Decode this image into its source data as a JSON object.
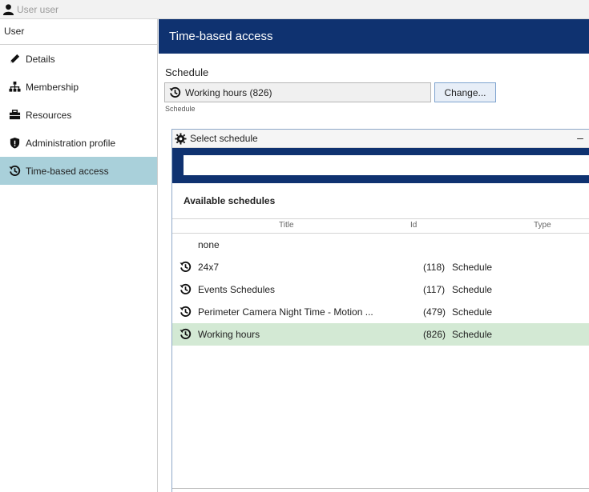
{
  "window": {
    "title": "User user"
  },
  "sidebar": {
    "header": "User",
    "items": [
      {
        "label": "Details",
        "icon": "pencil-icon"
      },
      {
        "label": "Membership",
        "icon": "hierarchy-icon"
      },
      {
        "label": "Resources",
        "icon": "briefcase-icon"
      },
      {
        "label": "Administration profile",
        "icon": "shield-icon"
      },
      {
        "label": "Time-based access",
        "icon": "schedule-icon",
        "active": true
      }
    ]
  },
  "main": {
    "title": "Time-based access",
    "schedule_label": "Schedule",
    "schedule_value": "Working hours (826)",
    "change_button": "Change...",
    "schedule_caption": "Schedule"
  },
  "popup": {
    "title": "Select schedule",
    "minimize": "–",
    "search_placeholder": "",
    "available_title": "Available schedules",
    "columns": {
      "title": "Title",
      "id": "Id",
      "type": "Type"
    },
    "rows": [
      {
        "title": "none",
        "id": "",
        "type": ""
      },
      {
        "title": "24x7",
        "id": "(118)",
        "type": "Schedule"
      },
      {
        "title": "Events Schedules",
        "id": "(117)",
        "type": "Schedule"
      },
      {
        "title": "Perimeter Camera Night Time - Motion ...",
        "id": "(479)",
        "type": "Schedule"
      },
      {
        "title": "Working hours",
        "id": "(826)",
        "type": "Schedule",
        "selected": true
      }
    ]
  },
  "colors": {
    "header_blue": "#0f3270",
    "active_nav": "#a9d0da",
    "selected_row": "#d3e9d4",
    "button_border": "#7ea3cf"
  }
}
